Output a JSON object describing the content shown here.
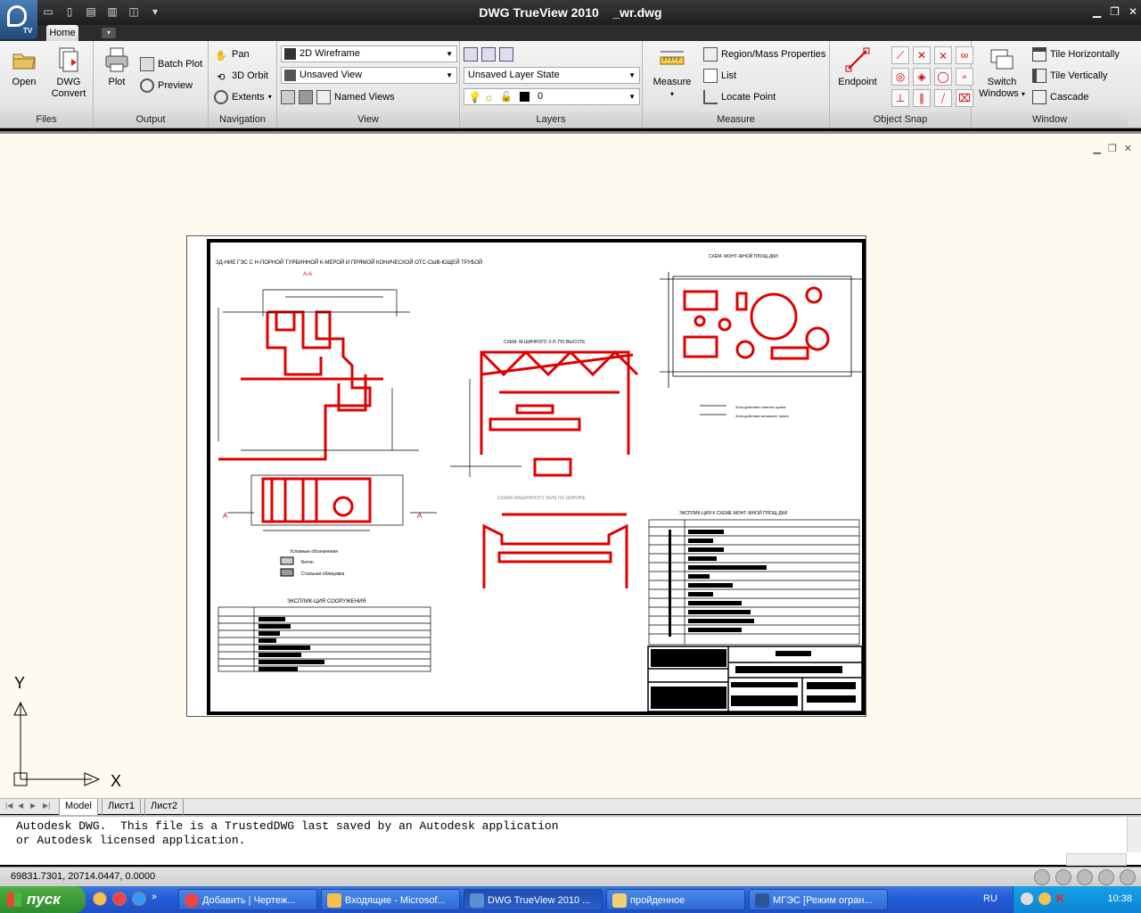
{
  "window": {
    "title": "DWG TrueView 2010    _wr.dwg",
    "app_badge": "TV"
  },
  "ribbon": {
    "tabs": [
      "Home"
    ],
    "panels": {
      "files": {
        "title": "Files",
        "open": "Open",
        "dwg_convert_1": "DWG",
        "dwg_convert_2": "Convert"
      },
      "output": {
        "title": "Output",
        "plot": "Plot",
        "batch_plot": "Batch Plot",
        "preview": "Preview"
      },
      "navigation": {
        "title": "Navigation",
        "pan": "Pan",
        "orbit": "3D Orbit",
        "extents": "Extents"
      },
      "view": {
        "title": "View",
        "visual_style": "2D Wireframe",
        "saved_view": "Unsaved View",
        "named_views": "Named Views"
      },
      "layers": {
        "title": "Layers",
        "layer_state": "Unsaved Layer State",
        "current_layer": "0"
      },
      "measure": {
        "title": "Measure",
        "measure": "Measure",
        "region_mass": "Region/Mass Properties",
        "list": "List",
        "locate_point": "Locate Point"
      },
      "object_snap": {
        "title": "Object Snap",
        "endpoint": "Endpoint"
      },
      "window_panel": {
        "title": "Window",
        "switch_1": "Switch",
        "switch_2": "Windows",
        "tile_h": "Tile Horizontally",
        "tile_v": "Tile Vertically",
        "cascade": "Cascade"
      }
    }
  },
  "drawing": {
    "main_title": "ЗД-НИЕ ГЭС С Н-ПОРНОЙ ТУРБИННОЙ К-МЕРОЙ И ПРЯМОЙ КОНИЧЕСКОЙ ОТС-СЫВ-ЮЩЕЙ ТРУБОЙ",
    "section_aa": "А-А",
    "plan_title": "СХЕМ- МОНТ-ЖНОЙ ПЛОЩ-ДКИ",
    "height_title": "СХЕМ- М-ШИННОГО З-Л- ПО ВЫСОТЕ",
    "width_title": "СХЕМА МАШИННОГО ЗАЛА ПО ШИРИНЕ",
    "legend_title": "Условные обозначения",
    "legend_1": "Бетон",
    "legend_2": "Стальная облицовка",
    "explication_1": "ЭКСПЛИК-ЦИЯ СООРУЖЕНИЯ",
    "explication_2": "ЭКСПЛИК-ЦИЯ К СХЕМЕ МОНТ-ЖНОЙ ПЛОЩ-ДКИ",
    "crane_note_1": "Зона действия главного крана",
    "crane_note_2": "Зона действия вспомогат. крана",
    "label_a": "А"
  },
  "axes": {
    "x": "X",
    "y": "Y"
  },
  "layout_tabs": [
    "Model",
    "Лист1",
    "Лист2"
  ],
  "command_line": {
    "text": "Autodesk DWG.  This file is a TrustedDWG last saved by an Autodesk application\nor Autodesk licensed application."
  },
  "status": {
    "coords": "69831.7301, 20714.0447, 0.0000"
  },
  "taskbar": {
    "start": "пуск",
    "tasks": [
      "Добавить | Чертеж...",
      "Входящие - Microsof...",
      "DWG TrueView 2010 ...",
      "пройденное",
      "МГЭС [Режим огран..."
    ],
    "lang": "RU",
    "clock": "10:38"
  },
  "colors": {
    "drawing_red": "#e00000",
    "canvas_bg": "#fdfbf0",
    "taskbar_blue": "#245edb"
  }
}
